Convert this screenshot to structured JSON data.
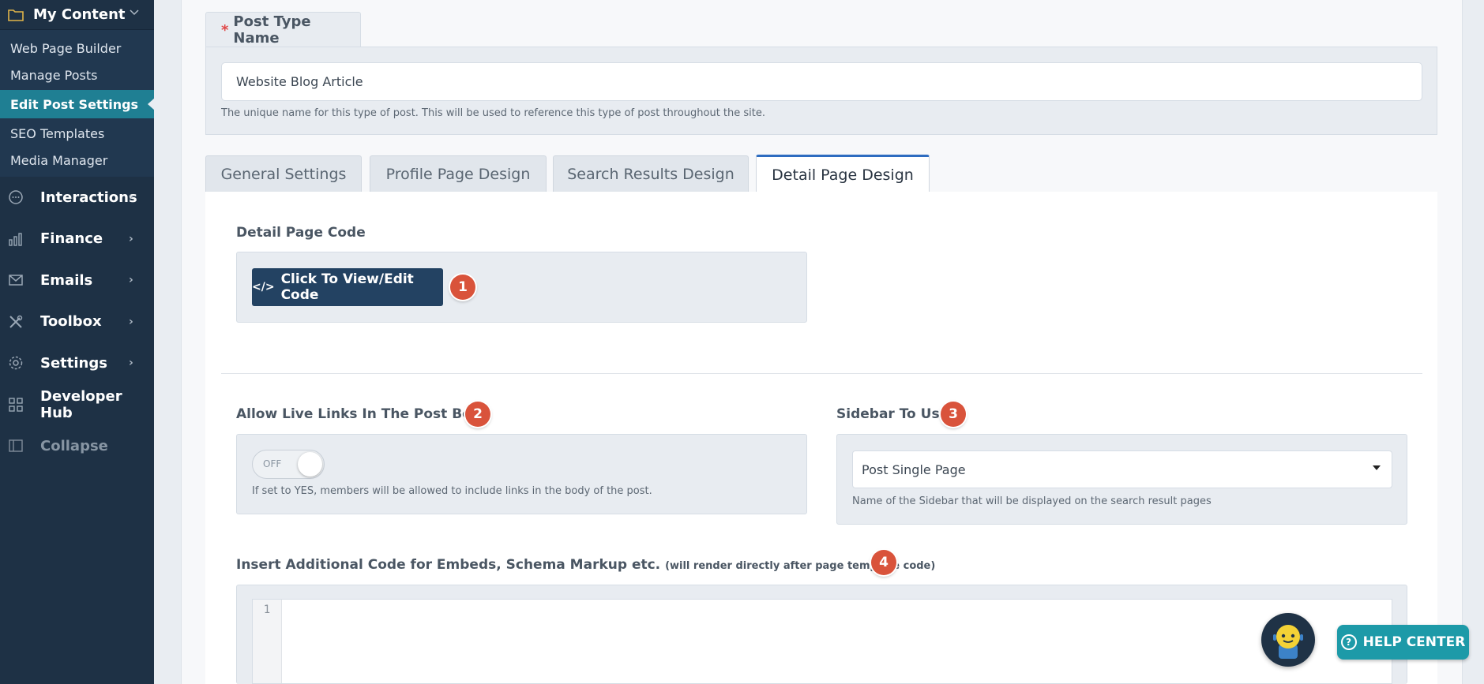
{
  "sidebar": {
    "top_label": "My Content",
    "sub_items": [
      {
        "label": "Web Page Builder"
      },
      {
        "label": "Manage Posts"
      },
      {
        "label": "Edit Post Settings"
      },
      {
        "label": "SEO Templates"
      },
      {
        "label": "Media Manager"
      }
    ],
    "items": [
      {
        "label": "Interactions",
        "icon": "chat-icon"
      },
      {
        "label": "Finance",
        "icon": "bar-chart-icon"
      },
      {
        "label": "Emails",
        "icon": "mail-icon"
      },
      {
        "label": "Toolbox",
        "icon": "tools-icon"
      },
      {
        "label": "Settings",
        "icon": "gear-icon"
      },
      {
        "label": "Developer Hub",
        "icon": "grid-icon"
      },
      {
        "label": "Collapse",
        "icon": "collapse-icon"
      }
    ]
  },
  "post_type": {
    "required_mark": "*",
    "label": "Post Type Name",
    "value": "Website Blog Article",
    "help": "The unique name for this type of post. This will be used to reference this type of post throughout the site."
  },
  "tabs": [
    {
      "label": "General Settings"
    },
    {
      "label": "Profile Page Design"
    },
    {
      "label": "Search Results Design"
    },
    {
      "label": "Detail Page Design"
    }
  ],
  "detail": {
    "code_label": "Detail Page Code",
    "code_button_icon": "</>",
    "code_button": "Click To View/Edit Code",
    "live_links_label": "Allow Live Links In The Post Body",
    "toggle_state": "OFF",
    "live_links_help": "If set to YES, members will be allowed to include links in the body of the post.",
    "sidebar_label": "Sidebar To Use",
    "sidebar_value": "Post Single Page",
    "sidebar_help": "Name of the Sidebar that will be displayed on the search result pages",
    "additional_label": "Insert Additional Code for Embeds, Schema Markup etc.",
    "additional_note": "(will render directly after page template code)",
    "editor_line": "1"
  },
  "badges": [
    "1",
    "2",
    "3",
    "4"
  ],
  "help_center": {
    "icon": "?",
    "label": "HELP CENTER"
  },
  "colors": {
    "sidebar_bg": "#1e3145",
    "active_item": "#1f7f93",
    "primary_button": "#234262",
    "badge": "#d9533b",
    "tab_active_border": "#2d6cc0",
    "help_center": "#1d9aa8"
  }
}
